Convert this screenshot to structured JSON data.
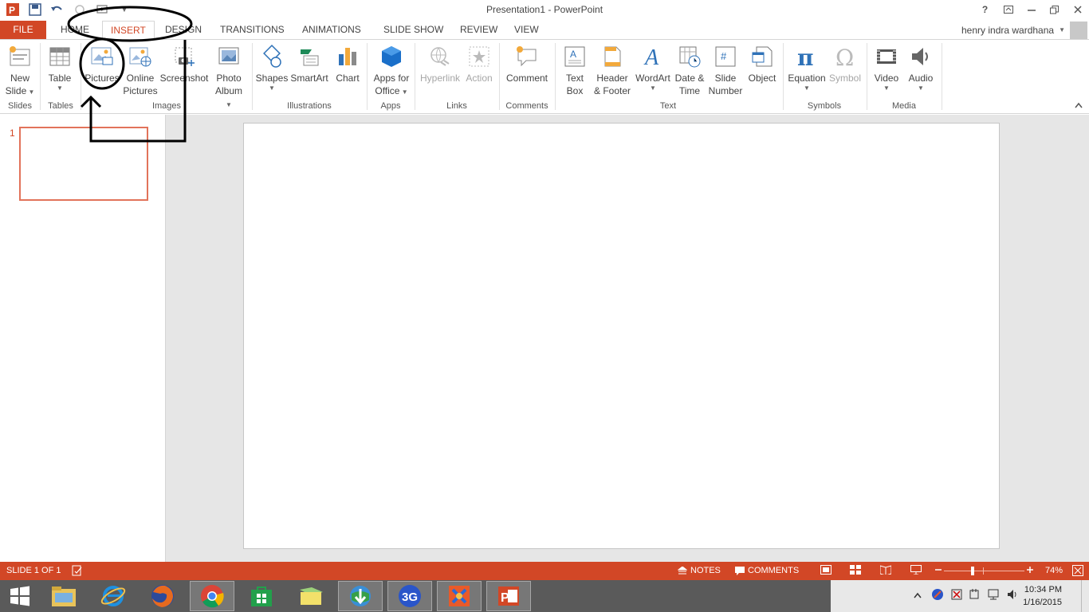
{
  "title_bar": {
    "title": "Presentation1 - PowerPoint"
  },
  "tabs": [
    {
      "label": "FILE"
    },
    {
      "label": "HOME"
    },
    {
      "label": "INSERT"
    },
    {
      "label": "DESIGN"
    },
    {
      "label": "TRANSITIONS"
    },
    {
      "label": "ANIMATIONS"
    },
    {
      "label": "SLIDE SHOW"
    },
    {
      "label": "REVIEW"
    },
    {
      "label": "VIEW"
    }
  ],
  "active_tab": "INSERT",
  "user": {
    "name": "henry indra wardhana"
  },
  "ribbon": {
    "buttons": {
      "new_slide": [
        "New",
        "Slide"
      ],
      "table": "Table",
      "pictures": "Pictures",
      "online_pictures": [
        "Online",
        "Pictures"
      ],
      "screenshot": "Screenshot",
      "photo_album": [
        "Photo",
        "Album"
      ],
      "shapes": "Shapes",
      "smartart": "SmartArt",
      "chart": "Chart",
      "apps_for_office": [
        "Apps for",
        "Office"
      ],
      "hyperlink": "Hyperlink",
      "action": "Action",
      "comment": "Comment",
      "text_box": [
        "Text",
        "Box"
      ],
      "header_footer": [
        "Header",
        "& Footer"
      ],
      "wordart": "WordArt",
      "date_time": [
        "Date &",
        "Time"
      ],
      "slide_number": [
        "Slide",
        "Number"
      ],
      "object": "Object",
      "equation": "Equation",
      "symbol": "Symbol",
      "video": "Video",
      "audio": "Audio"
    },
    "groups": {
      "slides": "Slides",
      "tables": "Tables",
      "images": "Images",
      "illustrations": "Illustrations",
      "apps": "Apps",
      "links": "Links",
      "comments": "Comments",
      "text": "Text",
      "symbols": "Symbols",
      "media": "Media"
    }
  },
  "thumbnails": [
    {
      "number": "1"
    }
  ],
  "status_bar": {
    "slide_info": "SLIDE 1 OF 1",
    "notes": "NOTES",
    "comments": "COMMENTS",
    "zoom": "74%"
  },
  "taskbar": {
    "apps": [
      "start",
      "file-explorer",
      "internet-explorer",
      "firefox",
      "chrome",
      "store",
      "folder",
      "internet-download-manager",
      "3g-modem",
      "app-tool",
      "powerpoint"
    ],
    "clock": {
      "time": "10:34 PM",
      "date": "1/16/2015"
    }
  },
  "colors": {
    "accent": "#d24726",
    "ribbon_bg": "#ffffff",
    "workspace_bg": "#e6e6e6"
  }
}
